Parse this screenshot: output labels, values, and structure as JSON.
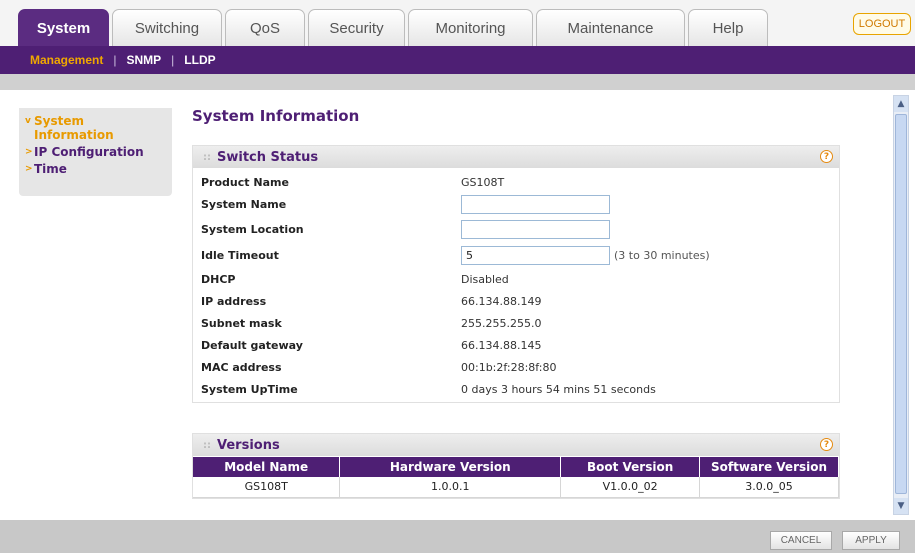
{
  "tabs": [
    {
      "label": "System",
      "active": true
    },
    {
      "label": "Switching",
      "active": false
    },
    {
      "label": "QoS",
      "active": false
    },
    {
      "label": "Security",
      "active": false
    },
    {
      "label": "Monitoring",
      "active": false
    },
    {
      "label": "Maintenance",
      "active": false
    },
    {
      "label": "Help",
      "active": false
    }
  ],
  "logout_label": "LOGOUT",
  "subnav": [
    {
      "label": "Management",
      "active": true
    },
    {
      "label": "SNMP",
      "active": false
    },
    {
      "label": "LLDP",
      "active": false
    }
  ],
  "left_menu": [
    {
      "line1": "System",
      "line2": "Information",
      "active": true
    },
    {
      "line1": "IP Configuration",
      "active": false
    },
    {
      "line1": "Time",
      "active": false
    }
  ],
  "page_title": "System Information",
  "switch_status": {
    "title": "Switch Status",
    "product_name_label": "Product Name",
    "product_name_value": "GS108T",
    "system_name_label": "System Name",
    "system_name_value": "",
    "system_location_label": "System Location",
    "system_location_value": "",
    "idle_timeout_label": "Idle Timeout",
    "idle_timeout_value": "5",
    "idle_timeout_hint": "(3 to 30 minutes)",
    "dhcp_label": "DHCP",
    "dhcp_value": "Disabled",
    "ip_label": "IP address",
    "ip_value": "66.134.88.149",
    "mask_label": "Subnet mask",
    "mask_value": "255.255.255.0",
    "gateway_label": "Default gateway",
    "gateway_value": "66.134.88.145",
    "mac_label": "MAC address",
    "mac_value": "00:1b:2f:28:8f:80",
    "uptime_label": "System UpTime",
    "uptime_value": "0 days 3 hours 54 mins 51 seconds"
  },
  "versions": {
    "title": "Versions",
    "headers": [
      "Model Name",
      "Hardware Version",
      "Boot Version",
      "Software Version"
    ],
    "row": [
      "GS108T",
      "1.0.0.1",
      "V1.0.0_02",
      "3.0.0_05"
    ]
  },
  "help_icon": "?",
  "footer": {
    "cancel_label": "CANCEL",
    "apply_label": "APPLY"
  },
  "colors": {
    "brand_purple": "#4e1f74",
    "accent_orange": "#e89a00"
  }
}
